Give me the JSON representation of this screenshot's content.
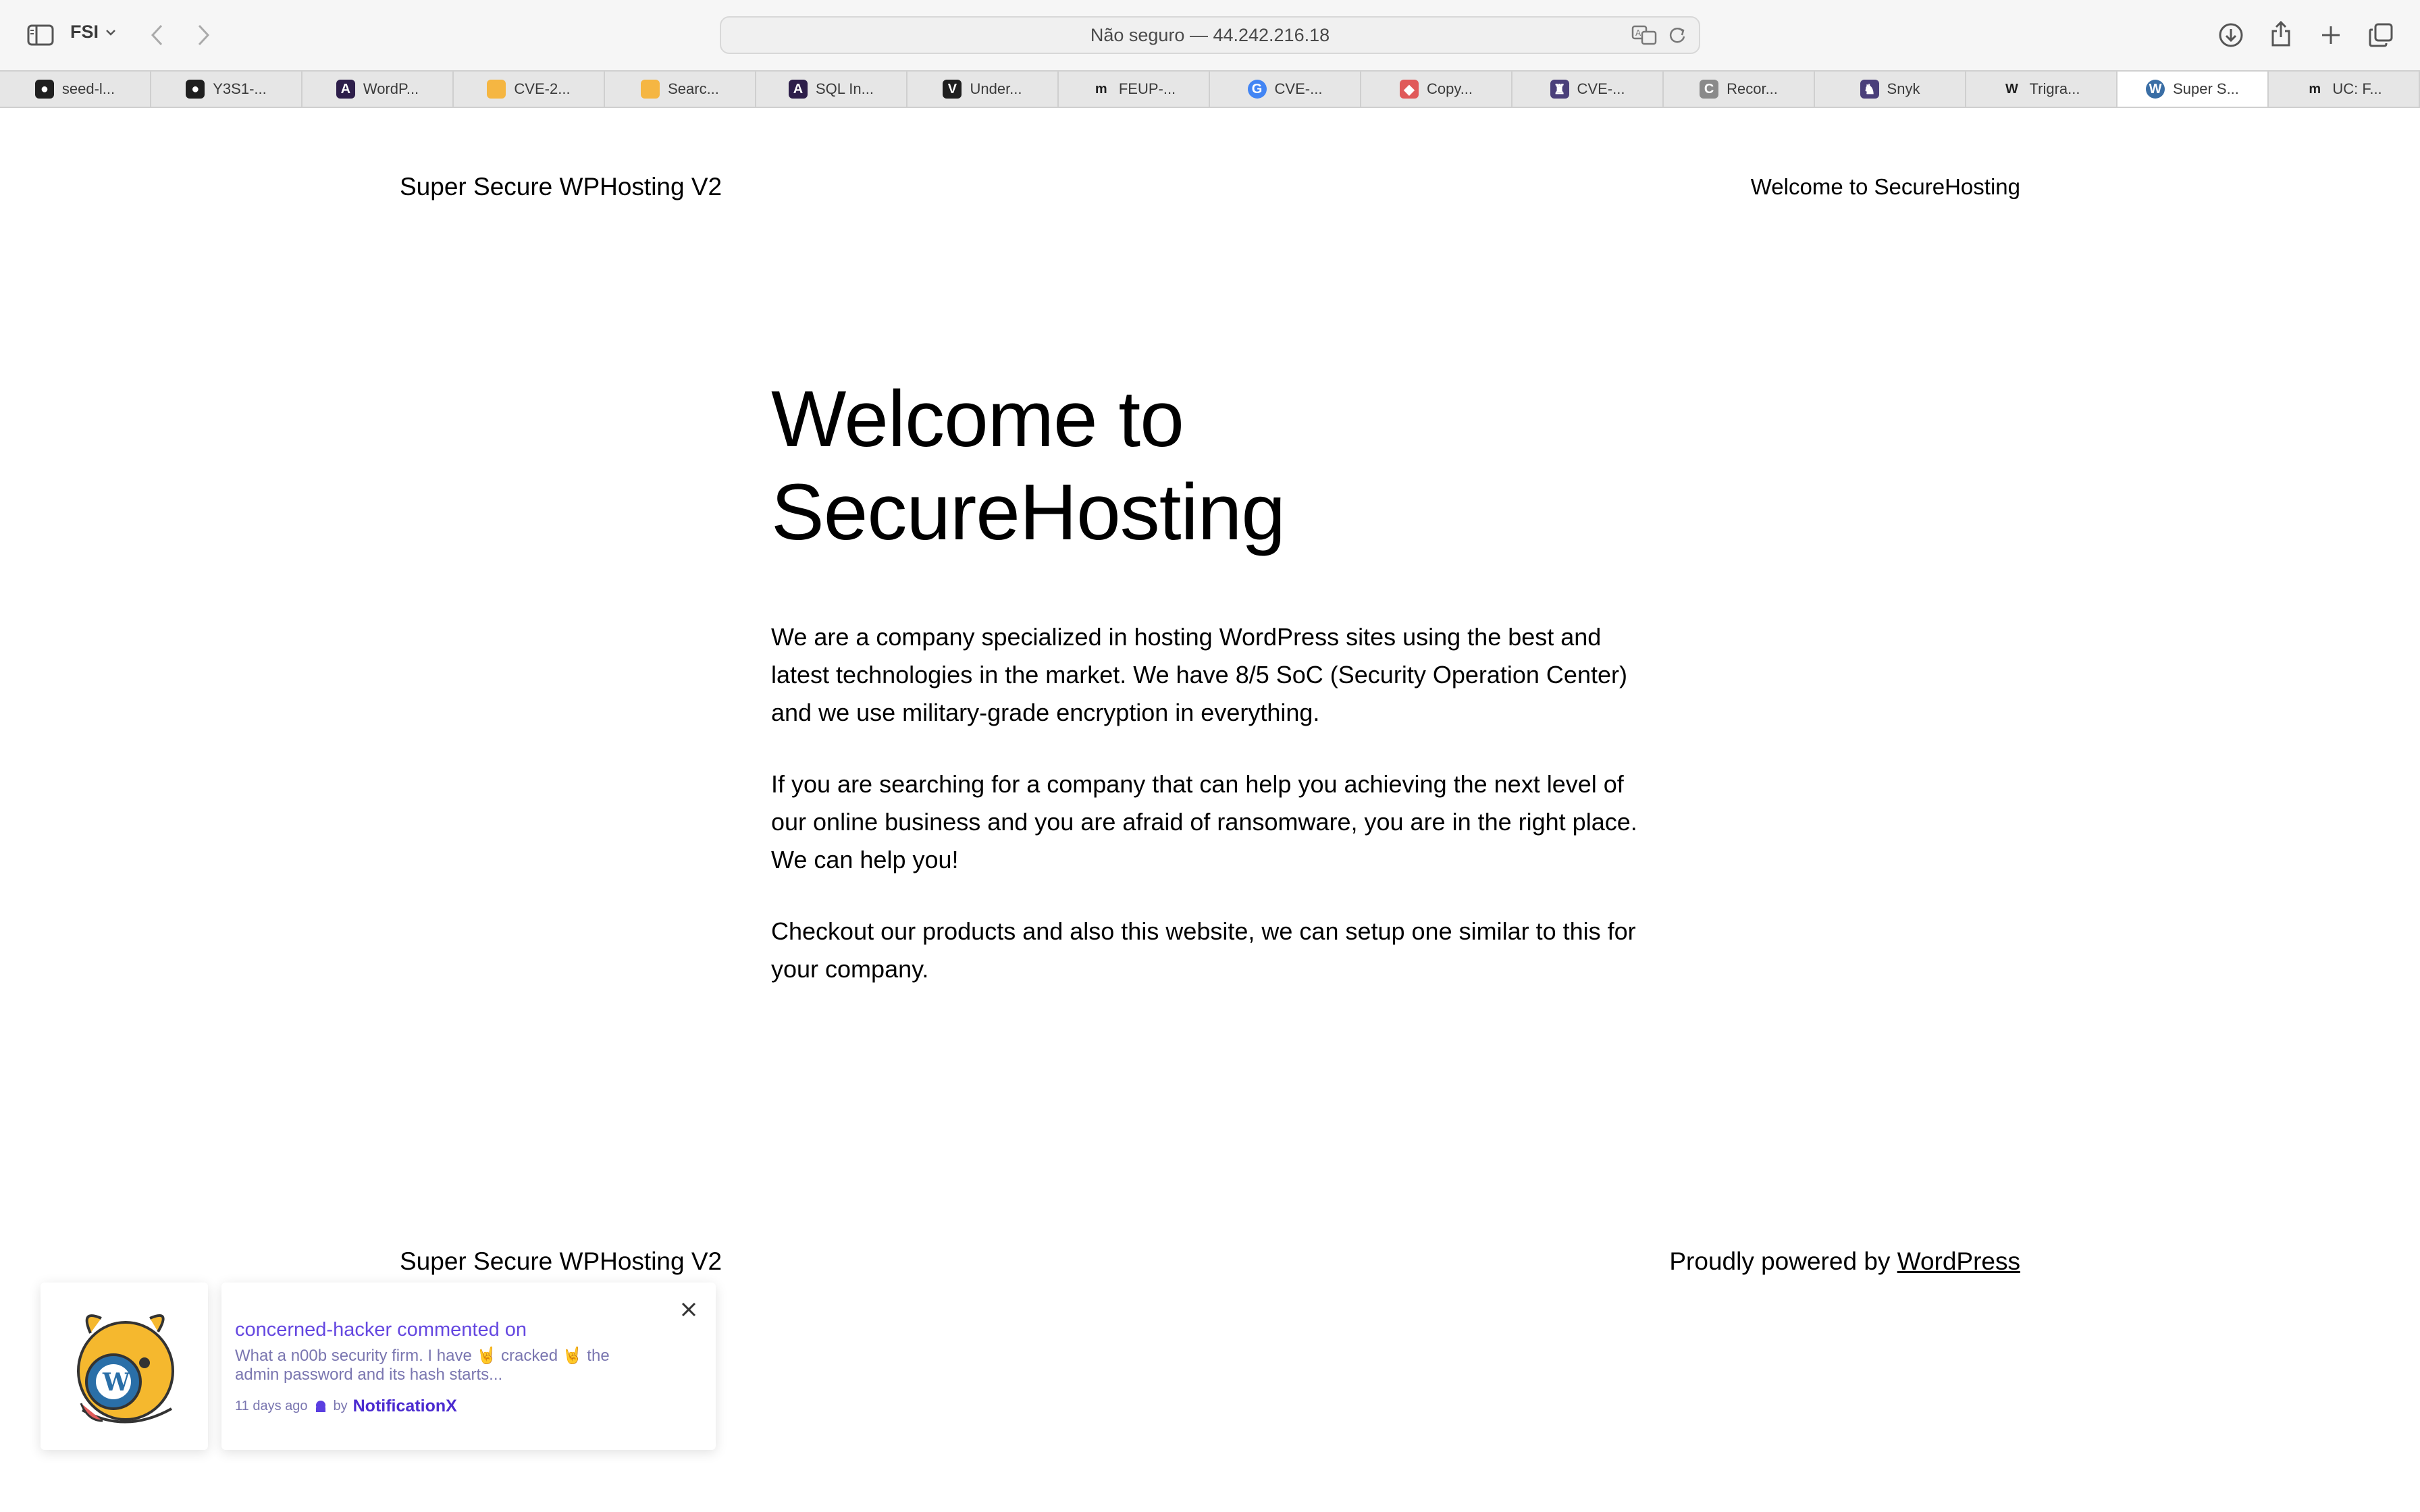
{
  "browser": {
    "profile": "FSI",
    "address": "Não seguro — 44.242.216.18",
    "tabs": [
      {
        "label": "seed-l...",
        "favicon": "github-icon",
        "color": "#1f1f1f"
      },
      {
        "label": "Y3S1-...",
        "favicon": "github-icon",
        "color": "#1f1f1f"
      },
      {
        "label": "WordP...",
        "favicon": "a-logo-icon",
        "color": "#2d1e4a"
      },
      {
        "label": "CVE-2...",
        "favicon": "square-icon",
        "color": "#f5b642"
      },
      {
        "label": "Searc...",
        "favicon": "square-icon",
        "color": "#f5b642"
      },
      {
        "label": "SQL In...",
        "favicon": "a-logo-icon",
        "color": "#2d1e4a"
      },
      {
        "label": "Under...",
        "favicon": "v-logo-icon",
        "color": "#1f1f1f"
      },
      {
        "label": "FEUP-...",
        "favicon": "m-logo-icon",
        "color": "#1f1f1f"
      },
      {
        "label": "CVE-...",
        "favicon": "google-icon",
        "color": "#4285f4"
      },
      {
        "label": "Copy...",
        "favicon": "shield-icon",
        "color": "#e05a5a"
      },
      {
        "label": "CVE-...",
        "favicon": "castle-icon",
        "color": "#4a3f7a"
      },
      {
        "label": "Recor...",
        "favicon": "c-logo-icon",
        "color": "#8a8a8a"
      },
      {
        "label": "Snyk",
        "favicon": "snyk-icon",
        "color": "#4a3f7a"
      },
      {
        "label": "Trigra...",
        "favicon": "wikipedia-icon",
        "color": "#1f1f1f"
      },
      {
        "label": "Super S...",
        "favicon": "wordpress-icon",
        "color": "#3a6ea5"
      },
      {
        "label": "UC: F...",
        "favicon": "m-logo-icon",
        "color": "#1f1f1f"
      }
    ],
    "active_tab": 14
  },
  "page": {
    "site_title": "Super Secure WPHosting V2",
    "nav_item": "Welcome to SecureHosting",
    "hero_line1": "Welcome to",
    "hero_line2": "SecureHosting",
    "paragraphs": [
      "We are a company specialized in hosting WordPress sites using the best and latest technologies in the market. We have 8/5 SoC (Security Operation Center) and we use military-grade encryption in everything.",
      "If you are searching for a company that can help you achieving the next level of our online business and you are afraid of ransomware, you are in the right place. We can help you!",
      "Checkout our products and also this website, we can setup one similar to this for your company."
    ],
    "footer_title": "Super Secure WPHosting V2",
    "footer_powered_prefix": "Proudly powered by ",
    "footer_powered_link": "WordPress"
  },
  "notification": {
    "title": "concerned-hacker commented on",
    "body_part1": "What a n00b security firm. I have ",
    "emoji": "🤘",
    "body_part2": " cracked ",
    "body_part3": " the admin password and its hash starts...",
    "time": "11 days ago",
    "by": "by",
    "brand": "NotificationX"
  }
}
